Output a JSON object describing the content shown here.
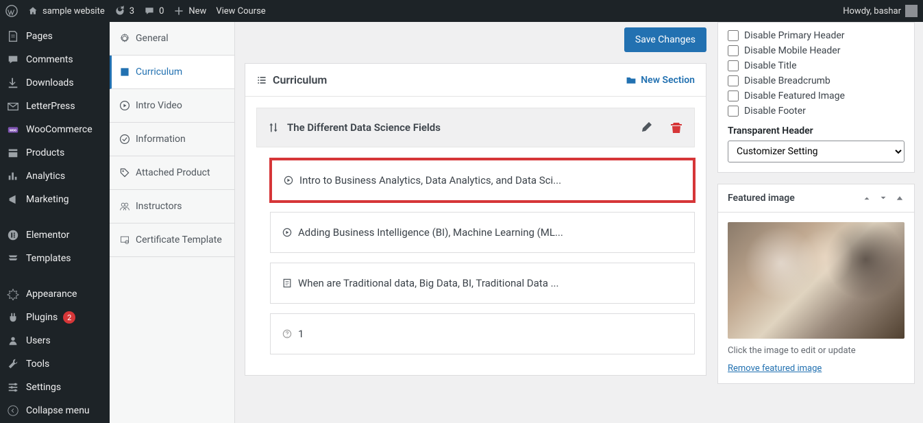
{
  "adminbar": {
    "site_name": "sample website",
    "updates_count": "3",
    "comments_count": "0",
    "new_label": "New",
    "view_course": "View Course",
    "howdy": "Howdy, bashar"
  },
  "adminmenu": [
    {
      "icon": "pages",
      "label": "Pages"
    },
    {
      "icon": "comments",
      "label": "Comments"
    },
    {
      "icon": "download",
      "label": "Downloads"
    },
    {
      "icon": "mail",
      "label": "LetterPress"
    },
    {
      "icon": "woo",
      "label": "WooCommerce"
    },
    {
      "icon": "products",
      "label": "Products"
    },
    {
      "icon": "analytics",
      "label": "Analytics"
    },
    {
      "icon": "marketing",
      "label": "Marketing"
    },
    {
      "icon": "elementor",
      "label": "Elementor"
    },
    {
      "icon": "templates",
      "label": "Templates"
    },
    {
      "icon": "appearance",
      "label": "Appearance"
    },
    {
      "icon": "plugins",
      "label": "Plugins",
      "badge": "2"
    },
    {
      "icon": "users",
      "label": "Users"
    },
    {
      "icon": "tools",
      "label": "Tools"
    },
    {
      "icon": "settings",
      "label": "Settings"
    },
    {
      "icon": "collapse",
      "label": "Collapse menu"
    }
  ],
  "tabs": [
    {
      "icon": "gear",
      "label": "General"
    },
    {
      "icon": "book",
      "label": "Curriculum",
      "active": true
    },
    {
      "icon": "play",
      "label": "Intro Video"
    },
    {
      "icon": "check",
      "label": "Information"
    },
    {
      "icon": "tag",
      "label": "Attached Product"
    },
    {
      "icon": "users",
      "label": "Instructors"
    },
    {
      "icon": "cert",
      "label": "Certificate Template"
    }
  ],
  "main": {
    "save_button": "Save Changes",
    "panel_title": "Curriculum",
    "new_section": "New Section",
    "section_title": "The Different Data Science Fields",
    "lessons": [
      {
        "icon": "play",
        "title": "Intro to Business Analytics, Data Analytics, and Data Sci...",
        "highlight": true
      },
      {
        "icon": "play",
        "title": "Adding Business Intelligence (BI), Machine Learning (ML..."
      },
      {
        "icon": "doc",
        "title": "When are Traditional data, Big Data, BI, Traditional Data ..."
      },
      {
        "icon": "question",
        "title": "1"
      }
    ]
  },
  "rside": {
    "disables": [
      "Disable Primary Header",
      "Disable Mobile Header",
      "Disable Title",
      "Disable Breadcrumb",
      "Disable Featured Image",
      "Disable Footer"
    ],
    "transparent_label": "Transparent Header",
    "transparent_value": "Customizer Setting",
    "featured_title": "Featured image",
    "featured_caption": "Click the image to edit or update",
    "remove_link": "Remove featured image"
  }
}
